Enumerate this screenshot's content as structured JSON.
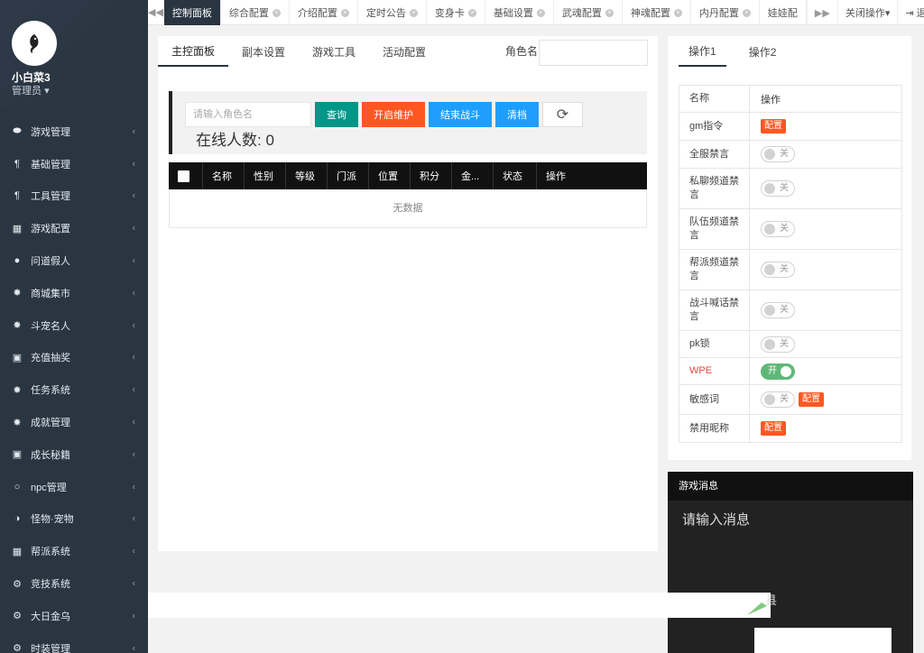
{
  "sidebar": {
    "user_name": "小白菜3",
    "user_role": "管理员",
    "items": [
      {
        "label": "游戏管理",
        "icon": "gamepad-icon"
      },
      {
        "label": "基础管理",
        "icon": "cutlery-icon"
      },
      {
        "label": "工具管理",
        "icon": "cutlery-icon"
      },
      {
        "label": "游戏配置",
        "icon": "table-icon"
      },
      {
        "label": "问道假人",
        "icon": "user-icon"
      },
      {
        "label": "商城集市",
        "icon": "gear-icon"
      },
      {
        "label": "斗宠名人",
        "icon": "gear-icon"
      },
      {
        "label": "充值抽奖",
        "icon": "money-icon"
      },
      {
        "label": "任务系统",
        "icon": "gear-icon"
      },
      {
        "label": "成就管理",
        "icon": "gear-icon"
      },
      {
        "label": "成长秘籍",
        "icon": "money-icon"
      },
      {
        "label": "npc管理",
        "icon": "circle-icon"
      },
      {
        "label": "怪物·宠物",
        "icon": "half-circle-icon"
      },
      {
        "label": "帮派系统",
        "icon": "table-icon"
      },
      {
        "label": "竞技系统",
        "icon": "cogs-icon"
      },
      {
        "label": "大日金乌",
        "icon": "cogs-icon"
      },
      {
        "label": "时装管理",
        "icon": "cogs-icon"
      }
    ]
  },
  "tabs": {
    "items": [
      {
        "label": "控制面板",
        "active": true,
        "closable": false
      },
      {
        "label": "综合配置",
        "closable": true
      },
      {
        "label": "介绍配置",
        "closable": true
      },
      {
        "label": "定时公告",
        "closable": true
      },
      {
        "label": "变身卡",
        "closable": true
      },
      {
        "label": "基础设置",
        "closable": true
      },
      {
        "label": "武魂配置",
        "closable": true
      },
      {
        "label": "神魂配置",
        "closable": true
      },
      {
        "label": "内丹配置",
        "closable": true
      },
      {
        "label": "娃娃配",
        "closable": false
      }
    ],
    "close_ops": "关闭操作",
    "logout": "退出"
  },
  "main": {
    "subtabs": [
      "主控面板",
      "副本设置",
      "游戏工具",
      "活动配置"
    ],
    "role_label": "角色名",
    "search_placeholder": "请输入角色名",
    "buttons": {
      "query": "查询",
      "maintenance": "开启维护",
      "end_battle": "结束战斗",
      "clear": "清档"
    },
    "online_label": "在线人数: 0",
    "table_headers": [
      "名称",
      "性别",
      "等级",
      "门派",
      "位置",
      "积分",
      "金...",
      "状态",
      "操作"
    ],
    "empty_text": "无数据"
  },
  "right": {
    "tabs": [
      "操作1",
      "操作2"
    ],
    "headers": [
      "名称",
      "操作"
    ],
    "rows": [
      {
        "name": "gm指令",
        "control": "config"
      },
      {
        "name": "全服禁言",
        "control": "switch",
        "state": "关"
      },
      {
        "name": "私聊频道禁言",
        "control": "switch",
        "state": "关"
      },
      {
        "name": "队伍频道禁言",
        "control": "switch",
        "state": "关"
      },
      {
        "name": "帮派频道禁言",
        "control": "switch",
        "state": "关"
      },
      {
        "name": "战斗喊话禁言",
        "control": "switch",
        "state": "关"
      },
      {
        "name": "pk锁",
        "control": "switch",
        "state": "关"
      },
      {
        "name": "WPE",
        "control": "switch",
        "state": "开"
      },
      {
        "name": "敏感词",
        "control": "switch_config",
        "state": "关"
      },
      {
        "name": "禁用昵称",
        "control": "config"
      }
    ],
    "config_label": "配置"
  },
  "message": {
    "title": "游戏消息",
    "placeholder": "请输入消息"
  },
  "overlay_glyph": "县",
  "colors": {
    "sidebar_bg": "#2a3542",
    "teal": "#009688",
    "orange": "#ff5722",
    "blue": "#1e9fff",
    "green_switch": "#5fb878",
    "wpe_red": "#e04b3f"
  }
}
